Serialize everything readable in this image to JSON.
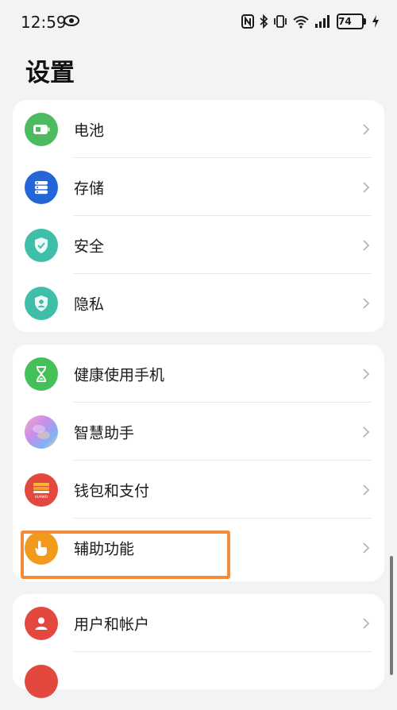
{
  "status_bar": {
    "time": "12:59",
    "battery": "74",
    "icons": [
      "eye-icon",
      "nfc-icon",
      "bluetooth-icon",
      "vibrate-icon",
      "wifi-icon",
      "signal-icon",
      "battery-icon",
      "charging-icon"
    ]
  },
  "page": {
    "title": "设置"
  },
  "groups": [
    {
      "items": [
        {
          "label": "电池",
          "icon": "battery-settings-icon",
          "color": "#4cba5e"
        },
        {
          "label": "存储",
          "icon": "storage-icon",
          "color": "#2466d8"
        },
        {
          "label": "安全",
          "icon": "security-shield-icon",
          "color": "#3fbfa8"
        },
        {
          "label": "隐私",
          "icon": "privacy-icon",
          "color": "#3fbfa8"
        }
      ]
    },
    {
      "items": [
        {
          "label": "健康使用手机",
          "icon": "hourglass-icon",
          "color": "#43c057"
        },
        {
          "label": "智慧助手",
          "icon": "assistant-orb-icon",
          "color": "#c88ee8"
        },
        {
          "label": "钱包和支付",
          "icon": "wallet-icon",
          "color": "#e2483d",
          "badge": "HUAWEI"
        },
        {
          "label": "辅助功能",
          "icon": "accessibility-hand-icon",
          "color": "#f29a1e"
        }
      ]
    },
    {
      "items": [
        {
          "label": "用户和帐户",
          "icon": "user-account-icon",
          "color": "#e2483d"
        }
      ]
    }
  ],
  "colors": {
    "background": "#f1f3f5",
    "card": "#ffffff",
    "highlight": "#f38b38"
  }
}
